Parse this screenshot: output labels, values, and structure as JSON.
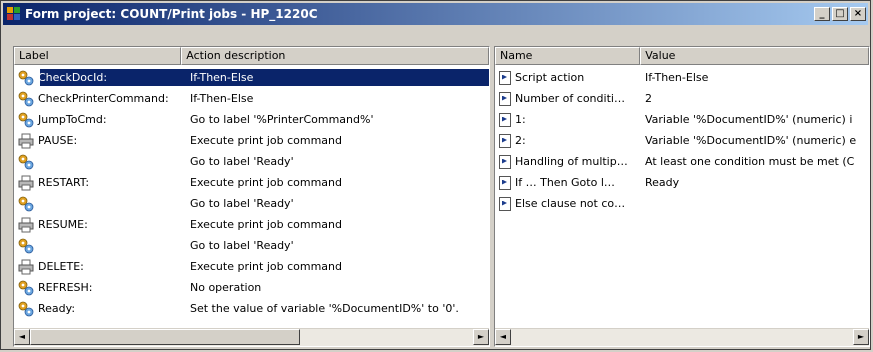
{
  "window": {
    "title": "Form project: COUNT/Print jobs - HP_1220C"
  },
  "left_pane": {
    "columns": [
      "Label",
      "Action description"
    ],
    "rows": [
      {
        "icon": "gears-icon",
        "label": "CheckDocId:",
        "action": "If-Then-Else",
        "selected": true
      },
      {
        "icon": "gears-icon",
        "label": "CheckPrinterCommand:",
        "action": "If-Then-Else"
      },
      {
        "icon": "gears-icon",
        "label": "JumpToCmd:",
        "action": "Go to label '%PrinterCommand%'"
      },
      {
        "icon": "printer-icon",
        "label": "PAUSE:",
        "action": "Execute print job command"
      },
      {
        "icon": "gears-icon",
        "label": "",
        "action": "Go to label 'Ready'"
      },
      {
        "icon": "printer-icon",
        "label": "RESTART:",
        "action": "Execute print job command"
      },
      {
        "icon": "gears-icon",
        "label": "",
        "action": "Go to label 'Ready'"
      },
      {
        "icon": "printer-icon",
        "label": "RESUME:",
        "action": "Execute print job command"
      },
      {
        "icon": "gears-icon",
        "label": "",
        "action": "Go to label 'Ready'"
      },
      {
        "icon": "printer-icon",
        "label": "DELETE:",
        "action": "Execute print job command"
      },
      {
        "icon": "gears-icon",
        "label": "REFRESH:",
        "action": "No operation"
      },
      {
        "icon": "gears-icon",
        "label": "Ready:",
        "action": "Set the value of variable '%DocumentID%' to '0'."
      }
    ]
  },
  "right_pane": {
    "columns": [
      "Name",
      "Value"
    ],
    "rows": [
      {
        "name": "Script action",
        "value": "If-Then-Else"
      },
      {
        "name": "Number of conditi…",
        "value": "2"
      },
      {
        "name": "1:",
        "value": "Variable '%DocumentID%' (numeric) i"
      },
      {
        "name": "2:",
        "value": "Variable '%DocumentID%' (numeric) e"
      },
      {
        "name": "Handling of multip…",
        "value": "At least one condition must be met (C"
      },
      {
        "name": "If … Then Goto l…",
        "value": "Ready"
      },
      {
        "name": "Else clause not co…",
        "value": ""
      }
    ]
  },
  "colors": {
    "title_start": "#0a246a",
    "title_end": "#a6caf0",
    "selection": "#0a246a"
  }
}
